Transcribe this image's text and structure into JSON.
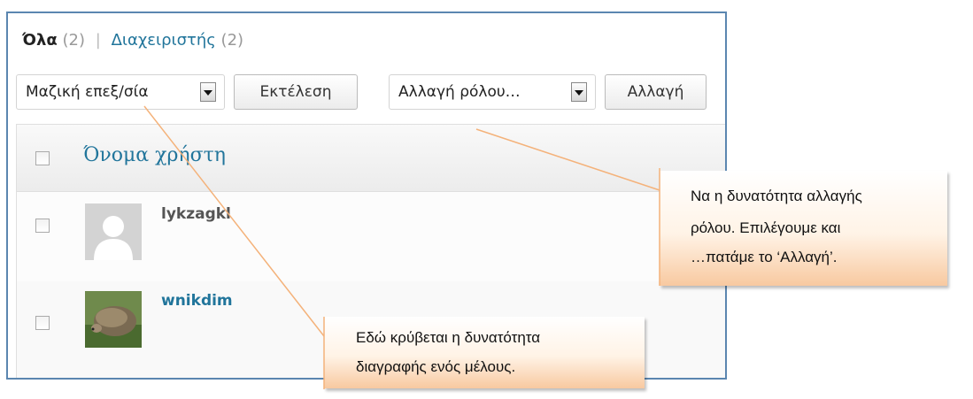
{
  "filters": {
    "all_label": "Όλα",
    "all_count": "(2)",
    "separator": "|",
    "admins_label": "Διαχειριστής",
    "admins_count": "(2)"
  },
  "bulk_actions": {
    "selected": "Μαζική επεξ/σία",
    "apply_label": "Εκτέλεση"
  },
  "change_role": {
    "selected": "Αλλαγή ρόλου…",
    "apply_label": "Αλλαγή"
  },
  "table": {
    "column_username": "Όνομα χρήστη",
    "rows": [
      {
        "username": "lykzagkl",
        "avatar": "default-avatar-icon"
      },
      {
        "username": "wnikdim",
        "avatar": "hedgehog-photo"
      }
    ]
  },
  "callouts": {
    "role_change_line1": "Να η δυνατότητα αλλαγής",
    "role_change_line2": "ρόλου. Επιλέγουμε και",
    "role_change_line3": "…πατάμε το ‘Αλλαγή’.",
    "delete_line1": "Εδώ κρύβεται η δυνατότητα",
    "delete_line2": "διαγραφής ενός μέλους."
  },
  "colors": {
    "link": "#21759b",
    "frame_border": "#5b86b0",
    "callout_line": "#f4b27a"
  }
}
